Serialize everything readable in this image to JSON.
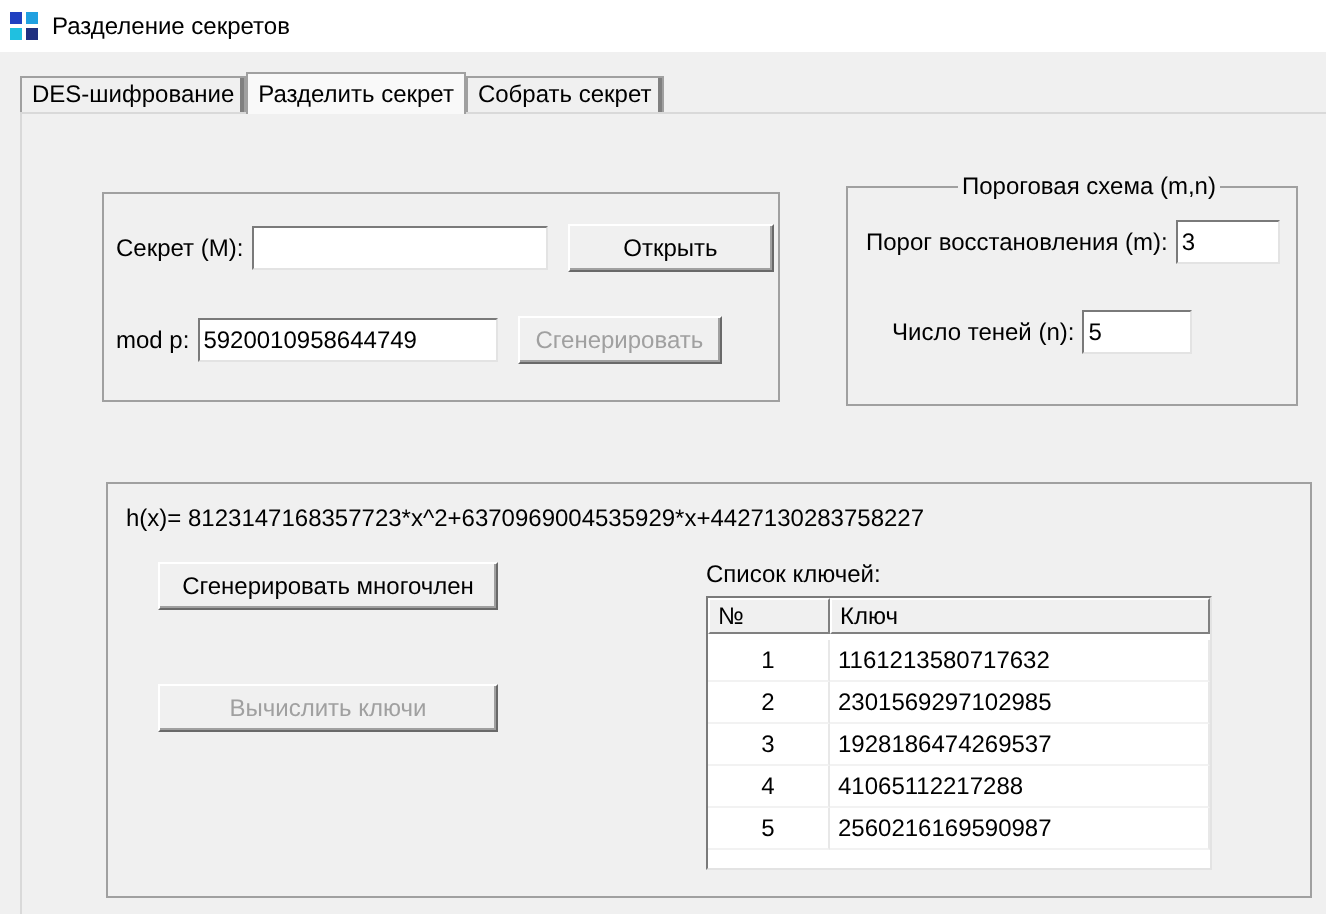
{
  "window": {
    "title": "Разделение секретов"
  },
  "tabs": [
    {
      "label": "DES-шифрование",
      "selected": false
    },
    {
      "label": "Разделить секрет",
      "selected": true
    },
    {
      "label": "Собрать секрет",
      "selected": false
    }
  ],
  "secret_group": {
    "secret_label": "Секрет (М):",
    "open_button": {
      "label": "Открыть",
      "disabled": false
    },
    "mod_label": "mod p:",
    "mod_value": "5920010958644749",
    "generate_button": {
      "label": "Сгенерировать",
      "disabled": true
    }
  },
  "threshold_group": {
    "title": "Пороговая схема (m,n)",
    "m_label": "Порог восстановления (m):",
    "m_value": "3",
    "n_label": "Число теней (n):",
    "n_value": "5"
  },
  "polynomial": "h(x)= 8123147168357723*x^2+6370969004535929*x+4427130283758227",
  "generate_poly_button": {
    "label": "Сгенерировать многочлен",
    "disabled": false
  },
  "compute_keys_button": {
    "label": "Вычислить ключи",
    "disabled": true
  },
  "keys": {
    "title": "Список ключей:",
    "columns": [
      "№",
      "Ключ"
    ],
    "rows": [
      [
        "1",
        "1161213580717632"
      ],
      [
        "2",
        "2301569297102985"
      ],
      [
        "3",
        "1928186474269537"
      ],
      [
        "4",
        "41065112217288"
      ],
      [
        "5",
        "2560216169590987"
      ]
    ]
  }
}
